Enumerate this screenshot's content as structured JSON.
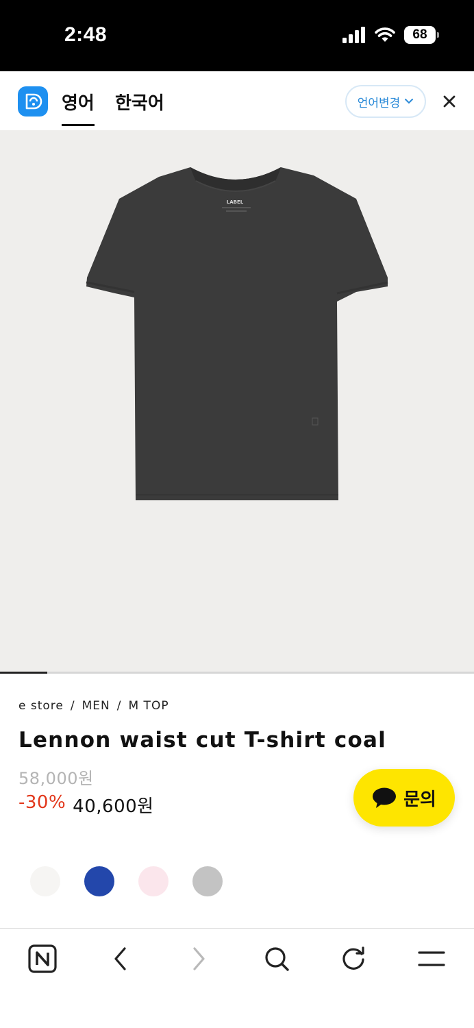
{
  "status_bar": {
    "time": "2:48",
    "battery": "68"
  },
  "translate_bar": {
    "tab_active": "영어",
    "tab_other": "한국어",
    "change_language": "언어변경"
  },
  "product": {
    "image": {
      "shirt_label": "LABEL"
    },
    "breadcrumb": [
      "e store",
      "/",
      "MEN",
      "/",
      "M TOP"
    ],
    "title": "Lennon waist cut T-shirt coal",
    "original_price": "58,000원",
    "discount": "-30%",
    "sale_price": "40,600원",
    "image_progress": 0.1,
    "color_swatches": [
      {
        "color": "#f6f5f3"
      },
      {
        "color": "#2347ab"
      },
      {
        "color": "#fbe6ec"
      },
      {
        "color": "#c3c3c3"
      }
    ]
  },
  "chat_button": {
    "label": "문의"
  },
  "toolbar": {
    "icons": [
      "naver-home-icon",
      "back-icon",
      "forward-icon",
      "search-icon",
      "reload-icon",
      "menu-icon"
    ]
  },
  "colors": {
    "accent_blue": "#1e90f0",
    "kakao_yellow": "#fee500",
    "discount_red": "#e2371b"
  }
}
